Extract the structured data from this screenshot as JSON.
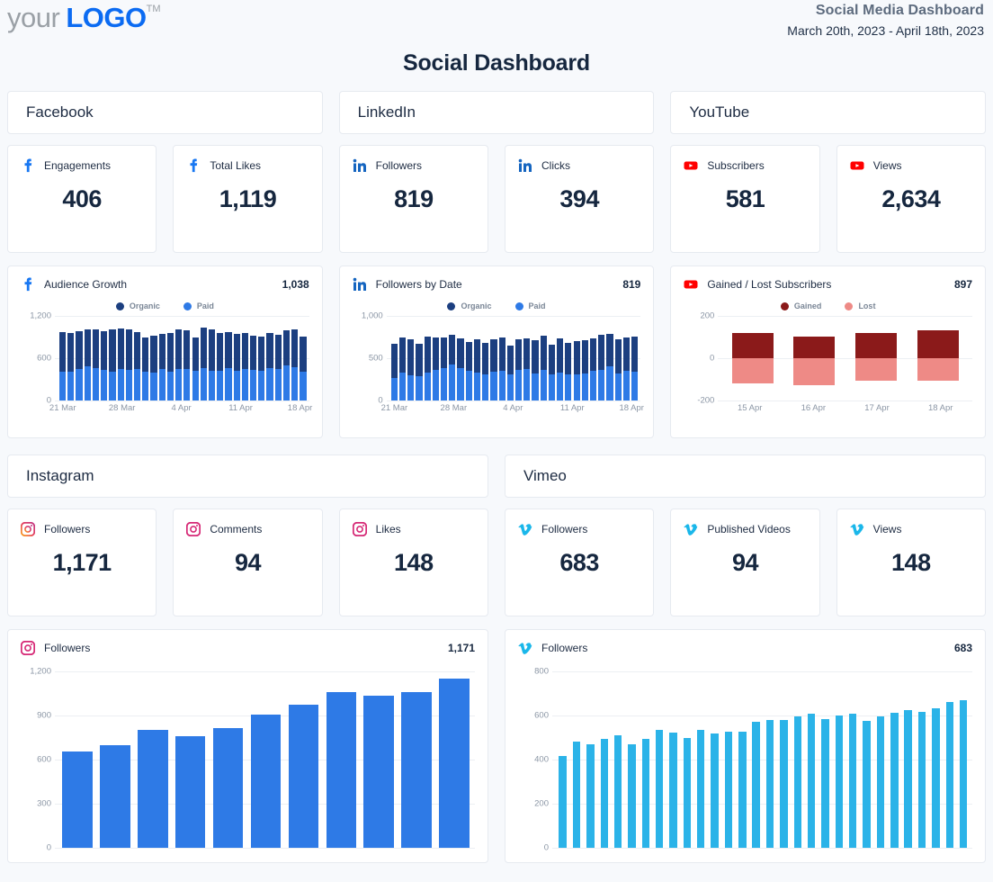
{
  "brand": {
    "logo_prefix": "your",
    "logo_main": "LOGO",
    "logo_tm": "TM",
    "accent": "#0b6bf2"
  },
  "header": {
    "title": "Social Media Dashboard",
    "date_range": "March 20th, 2023 - April 18th, 2023",
    "page_title": "Social Dashboard"
  },
  "sections": {
    "facebook": {
      "name": "Facebook",
      "icon": "facebook-icon",
      "color": "#1877f2"
    },
    "linkedin": {
      "name": "LinkedIn",
      "icon": "linkedin-icon",
      "color": "#1565c0"
    },
    "youtube": {
      "name": "YouTube",
      "icon": "youtube-icon",
      "color": "#ff0000"
    },
    "instagram": {
      "name": "Instagram",
      "icon": "instagram-icon",
      "color": "#e1306c"
    },
    "vimeo": {
      "name": "Vimeo",
      "icon": "vimeo-icon",
      "color": "#1ab7ea"
    }
  },
  "stats": {
    "facebook": [
      {
        "label": "Engagements",
        "value": "406"
      },
      {
        "label": "Total Likes",
        "value": "1,119"
      }
    ],
    "linkedin": [
      {
        "label": "Followers",
        "value": "819"
      },
      {
        "label": "Clicks",
        "value": "394"
      }
    ],
    "youtube": [
      {
        "label": "Subscribers",
        "value": "581"
      },
      {
        "label": "Views",
        "value": "2,634"
      }
    ],
    "instagram": [
      {
        "label": "Followers",
        "value": "1,171"
      },
      {
        "label": "Comments",
        "value": "94"
      },
      {
        "label": "Likes",
        "value": "148"
      }
    ],
    "vimeo": [
      {
        "label": "Followers",
        "value": "683"
      },
      {
        "label": "Published Videos",
        "value": "94"
      },
      {
        "label": "Views",
        "value": "148"
      }
    ]
  },
  "chart_data": [
    {
      "id": "fb-audience-growth",
      "type": "bar",
      "stacked": true,
      "title": "Audience Growth",
      "total_label": "1,038",
      "platform": "facebook",
      "xlabel": "",
      "ylabel": "",
      "ylim": [
        0,
        1200
      ],
      "yticks": [
        0,
        600,
        1200
      ],
      "ytick_labels": [
        "0",
        "600",
        "1,200"
      ],
      "grid": true,
      "legend_position": "top-center",
      "x": [
        "21 Mar",
        "22 Mar",
        "23 Mar",
        "24 Mar",
        "25 Mar",
        "26 Mar",
        "27 Mar",
        "28 Mar",
        "29 Mar",
        "30 Mar",
        "31 Mar",
        "1 Apr",
        "2 Apr",
        "3 Apr",
        "4 Apr",
        "5 Apr",
        "6 Apr",
        "7 Apr",
        "8 Apr",
        "9 Apr",
        "10 Apr",
        "11 Apr",
        "12 Apr",
        "13 Apr",
        "14 Apr",
        "15 Apr",
        "16 Apr",
        "17 Apr",
        "18 Apr",
        "19 Apr"
      ],
      "xtick_labels": [
        "21 Mar",
        "28 Mar",
        "4 Apr",
        "11 Apr",
        "18 Apr"
      ],
      "xtick_indices": [
        0,
        7,
        14,
        21,
        28
      ],
      "series": [
        {
          "name": "Paid",
          "color": "#2e7ae6",
          "values": [
            410,
            415,
            445,
            490,
            455,
            435,
            410,
            450,
            435,
            450,
            415,
            400,
            450,
            405,
            445,
            450,
            420,
            455,
            420,
            420,
            465,
            420,
            445,
            435,
            420,
            455,
            445,
            500,
            475,
            410
          ]
        },
        {
          "name": "Organic",
          "color": "#1c3f80",
          "values": [
            555,
            545,
            540,
            520,
            555,
            545,
            600,
            570,
            570,
            520,
            475,
            520,
            500,
            555,
            560,
            540,
            475,
            575,
            595,
            540,
            500,
            525,
            510,
            490,
            490,
            500,
            490,
            490,
            540,
            500
          ]
        }
      ]
    },
    {
      "id": "li-followers-by-date",
      "type": "bar",
      "stacked": true,
      "title": "Followers by Date",
      "total_label": "819",
      "platform": "linkedin",
      "xlabel": "",
      "ylabel": "",
      "ylim": [
        0,
        1000
      ],
      "yticks": [
        0,
        500,
        1000
      ],
      "ytick_labels": [
        "0",
        "500",
        "1,000"
      ],
      "grid": true,
      "legend_position": "top-center",
      "x": [
        "21 Mar",
        "22 Mar",
        "23 Mar",
        "24 Mar",
        "25 Mar",
        "26 Mar",
        "27 Mar",
        "28 Mar",
        "29 Mar",
        "30 Mar",
        "31 Mar",
        "1 Apr",
        "2 Apr",
        "3 Apr",
        "4 Apr",
        "5 Apr",
        "6 Apr",
        "7 Apr",
        "8 Apr",
        "9 Apr",
        "10 Apr",
        "11 Apr",
        "12 Apr",
        "13 Apr",
        "14 Apr",
        "15 Apr",
        "16 Apr",
        "17 Apr",
        "18 Apr",
        "19 Apr"
      ],
      "xtick_labels": [
        "21 Mar",
        "28 Mar",
        "4 Apr",
        "11 Apr",
        "18 Apr"
      ],
      "xtick_indices": [
        0,
        7,
        14,
        21,
        28
      ],
      "series": [
        {
          "name": "Paid",
          "color": "#2e7ae6",
          "values": [
            270,
            325,
            300,
            290,
            335,
            365,
            385,
            425,
            380,
            355,
            325,
            310,
            345,
            350,
            305,
            365,
            370,
            320,
            360,
            310,
            325,
            305,
            310,
            320,
            355,
            365,
            400,
            320,
            355,
            345
          ]
        },
        {
          "name": "Organic",
          "color": "#1c3f80",
          "values": [
            405,
            420,
            420,
            385,
            420,
            375,
            360,
            355,
            355,
            340,
            400,
            375,
            380,
            395,
            345,
            360,
            360,
            390,
            405,
            355,
            410,
            375,
            395,
            390,
            375,
            415,
            385,
            400,
            395,
            415
          ]
        }
      ]
    },
    {
      "id": "yt-gained-lost-subscribers",
      "type": "bar",
      "stacked": false,
      "diverging": true,
      "title": "Gained / Lost Subscribers",
      "total_label": "897",
      "platform": "youtube",
      "xlabel": "",
      "ylabel": "",
      "ylim": [
        -200,
        200
      ],
      "yticks": [
        -200,
        0,
        200
      ],
      "ytick_labels": [
        "-200",
        "0",
        "200"
      ],
      "grid": true,
      "legend_position": "top-center",
      "categories": [
        "15 Apr",
        "16 Apr",
        "17 Apr",
        "18 Apr"
      ],
      "series": [
        {
          "name": "Gained",
          "color": "#8b1a1a",
          "values": [
            118,
            102,
            118,
            133
          ]
        },
        {
          "name": "Lost",
          "color": "#ee8a86",
          "values": [
            -118,
            -128,
            -108,
            -105
          ]
        }
      ]
    },
    {
      "id": "ig-followers",
      "type": "bar",
      "stacked": false,
      "title": "Followers",
      "total_label": "1,171",
      "platform": "instagram",
      "xlabel": "",
      "ylabel": "",
      "ylim": [
        0,
        1200
      ],
      "yticks": [
        0,
        300,
        600,
        900,
        1200
      ],
      "ytick_labels": [
        "0",
        "300",
        "600",
        "900",
        "1,200"
      ],
      "grid": true,
      "series": [
        {
          "name": "Followers",
          "color": "#2e7ae6",
          "values": [
            655,
            700,
            805,
            760,
            815,
            905,
            975,
            1060,
            1035,
            1060,
            1150
          ]
        }
      ]
    },
    {
      "id": "vimeo-followers",
      "type": "bar",
      "stacked": false,
      "title": "Followers",
      "total_label": "683",
      "platform": "vimeo",
      "xlabel": "",
      "ylabel": "",
      "ylim": [
        0,
        800
      ],
      "yticks": [
        0,
        200,
        400,
        600,
        800
      ],
      "ytick_labels": [
        "0",
        "200",
        "400",
        "600",
        "800"
      ],
      "grid": true,
      "series": [
        {
          "name": "Followers",
          "color": "#2bb3e8",
          "values": [
            415,
            480,
            470,
            495,
            510,
            468,
            495,
            533,
            521,
            498,
            536,
            518,
            528,
            528,
            571,
            578,
            578,
            594,
            610,
            585,
            602,
            608,
            577,
            594,
            611,
            626,
            617,
            633,
            660,
            670
          ]
        }
      ]
    }
  ]
}
